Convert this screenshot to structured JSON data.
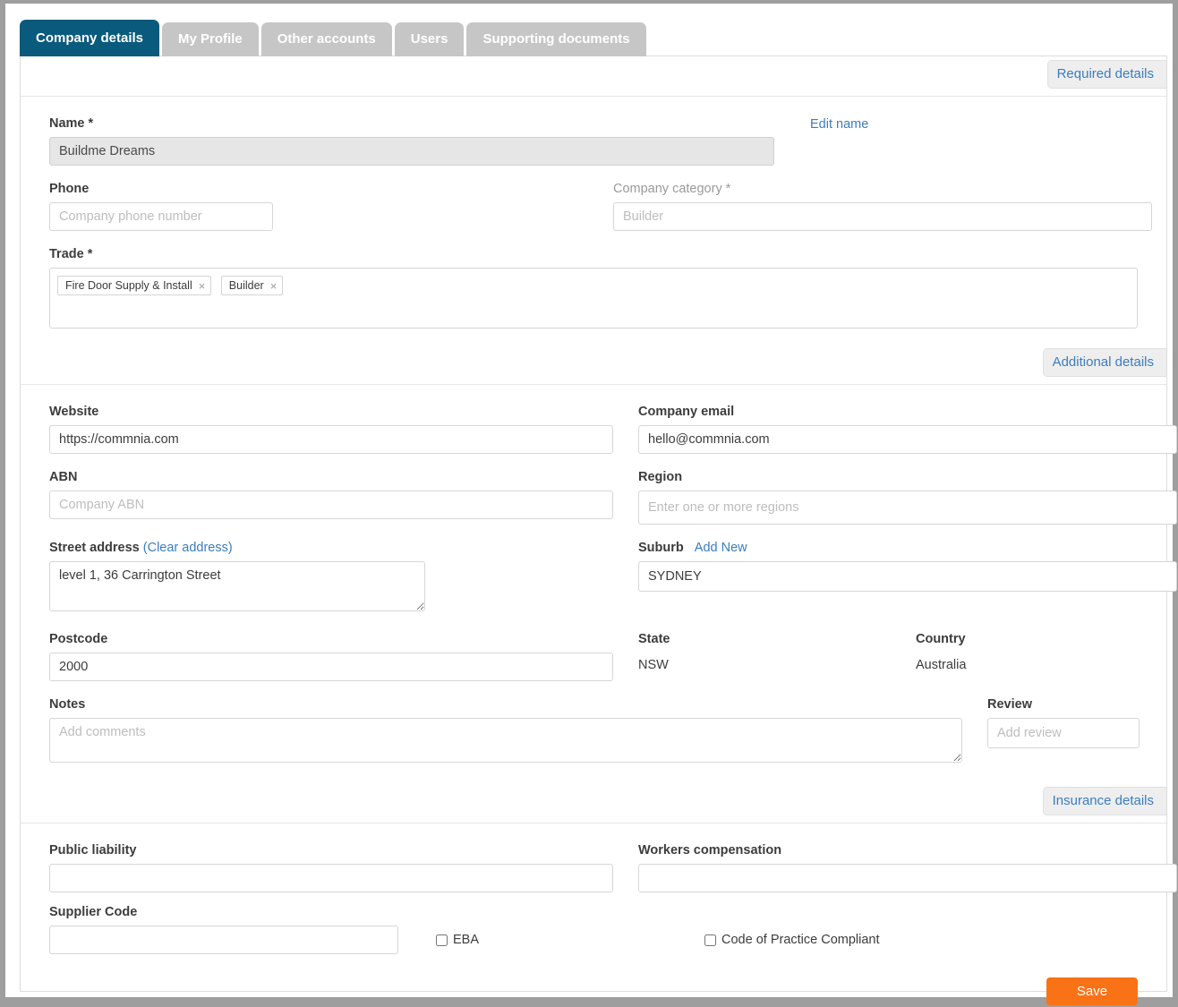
{
  "tabs": [
    {
      "label": "Company details",
      "active": true
    },
    {
      "label": "My Profile",
      "active": false
    },
    {
      "label": "Other accounts",
      "active": false
    },
    {
      "label": "Users",
      "active": false
    },
    {
      "label": "Supporting documents",
      "active": false
    }
  ],
  "sections": {
    "required_badge": "Required details",
    "additional_badge": "Additional details",
    "insurance_badge": "Insurance details"
  },
  "required": {
    "name_label": "Name *",
    "name_value": "Buildme Dreams",
    "edit_name_link": "Edit name",
    "phone_label": "Phone",
    "phone_placeholder": "Company phone number",
    "phone_value": "",
    "company_category_label": "Company category *",
    "company_category_placeholder": "Builder",
    "company_category_value": "",
    "trade_label": "Trade *",
    "trade_tags": [
      "Fire Door Supply & Install",
      "Builder"
    ],
    "tag_remove_icon": "×"
  },
  "additional": {
    "website_label": "Website",
    "website_value": "https://commnia.com",
    "company_email_label": "Company email",
    "company_email_value": "hello@commnia.com",
    "abn_label": "ABN",
    "abn_placeholder": "Company ABN",
    "abn_value": "",
    "region_label": "Region",
    "region_placeholder": "Enter one or more regions",
    "region_value": "",
    "street_address_label": "Street address",
    "clear_address_link": "(Clear address)",
    "street_address_value": "level 1, 36 Carrington Street",
    "suburb_label": "Suburb",
    "add_new_link": "Add New",
    "suburb_value": "SYDNEY",
    "postcode_label": "Postcode",
    "postcode_value": "2000",
    "state_label": "State",
    "state_value": "NSW",
    "country_label": "Country",
    "country_value": "Australia",
    "notes_label": "Notes",
    "notes_placeholder": "Add comments",
    "notes_value": "",
    "review_label": "Review",
    "review_placeholder": "Add review",
    "review_value": ""
  },
  "insurance": {
    "public_liability_label": "Public liability",
    "public_liability_value": "",
    "workers_comp_label": "Workers compensation",
    "workers_comp_value": "",
    "supplier_code_label": "Supplier Code",
    "supplier_code_value": "",
    "eba_label": "EBA",
    "eba_checked": false,
    "code_of_practice_label": "Code of Practice Compliant",
    "code_of_practice_checked": false
  },
  "footer": {
    "save_label": "Save"
  },
  "colors": {
    "active_tab": "#0a5a7d",
    "inactive_tab": "#c6c6c6",
    "link": "#3b7dbf",
    "save_button": "#f97316",
    "page_bg": "#9e9e9e"
  }
}
